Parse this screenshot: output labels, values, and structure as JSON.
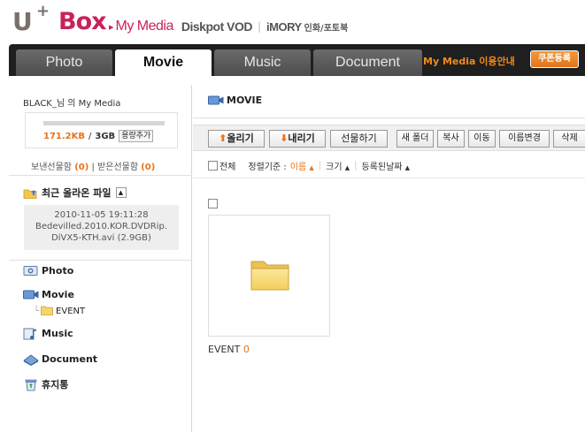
{
  "brand": {
    "u": "U",
    "plus": "+",
    "box": "Box"
  },
  "service_nav": {
    "arrow": "▸",
    "mymedia": "My Media",
    "diskpot": "Diskpot VOD",
    "sep": "|",
    "imory": "iMORY",
    "imory_sub": "인화/포토북"
  },
  "tabs": [
    {
      "label": "Photo",
      "active": false
    },
    {
      "label": "Movie",
      "active": true
    },
    {
      "label": "Music",
      "active": false
    },
    {
      "label": "Document",
      "active": false
    }
  ],
  "tabbar_guide": "My Media 이용안내",
  "coupon_label": "쿠폰등록",
  "sidebar": {
    "user_title": "BLACK_님 의 My Media",
    "storage_used": "171.2KB",
    "storage_sep": "/",
    "storage_total": "3GB",
    "storage_add": "용량추가",
    "storage_fill_fraction": 0.0001,
    "gift_sent": "보낸선물함",
    "gift_sent_count": "(0)",
    "gift_divider": "|",
    "gift_received": "받은선물함",
    "gift_received_count": "(0)",
    "recent_title": "최근 올라온 파일",
    "recent_collapse": "▲",
    "recent_file": {
      "date": "2010-11-05 19:11:28",
      "name_line1": "Bedevilled.2010.KOR.DVDRip.",
      "name_line2": "DiVX5-KTH.avi (2.9GB)"
    },
    "tree": {
      "photo": "Photo",
      "movie": "Movie",
      "event": "EVENT",
      "music": "Music",
      "document": "Document",
      "trash": "휴지통"
    }
  },
  "main": {
    "path_title": "MOVIE",
    "toolbar": {
      "upload": "올리기",
      "download": "내리기",
      "gift": "선물하기",
      "new_folder": "새 폴더",
      "copy": "복사",
      "move": "이동",
      "rename": "이름변경",
      "delete": "삭제"
    },
    "sort": {
      "select_all": "전체",
      "sort_by": "정렬기준 :",
      "by_name": "이름",
      "by_size": "크기",
      "by_date": "등록된날짜",
      "active_arrow": "▲",
      "arrow": "▲",
      "sep": "|"
    },
    "items": [
      {
        "name": "EVENT",
        "count": "0"
      }
    ]
  },
  "colors": {
    "brand_pink": "#c8235a",
    "accent_orange": "#e6731c",
    "tabbar_dark": "#1f1f1f"
  }
}
